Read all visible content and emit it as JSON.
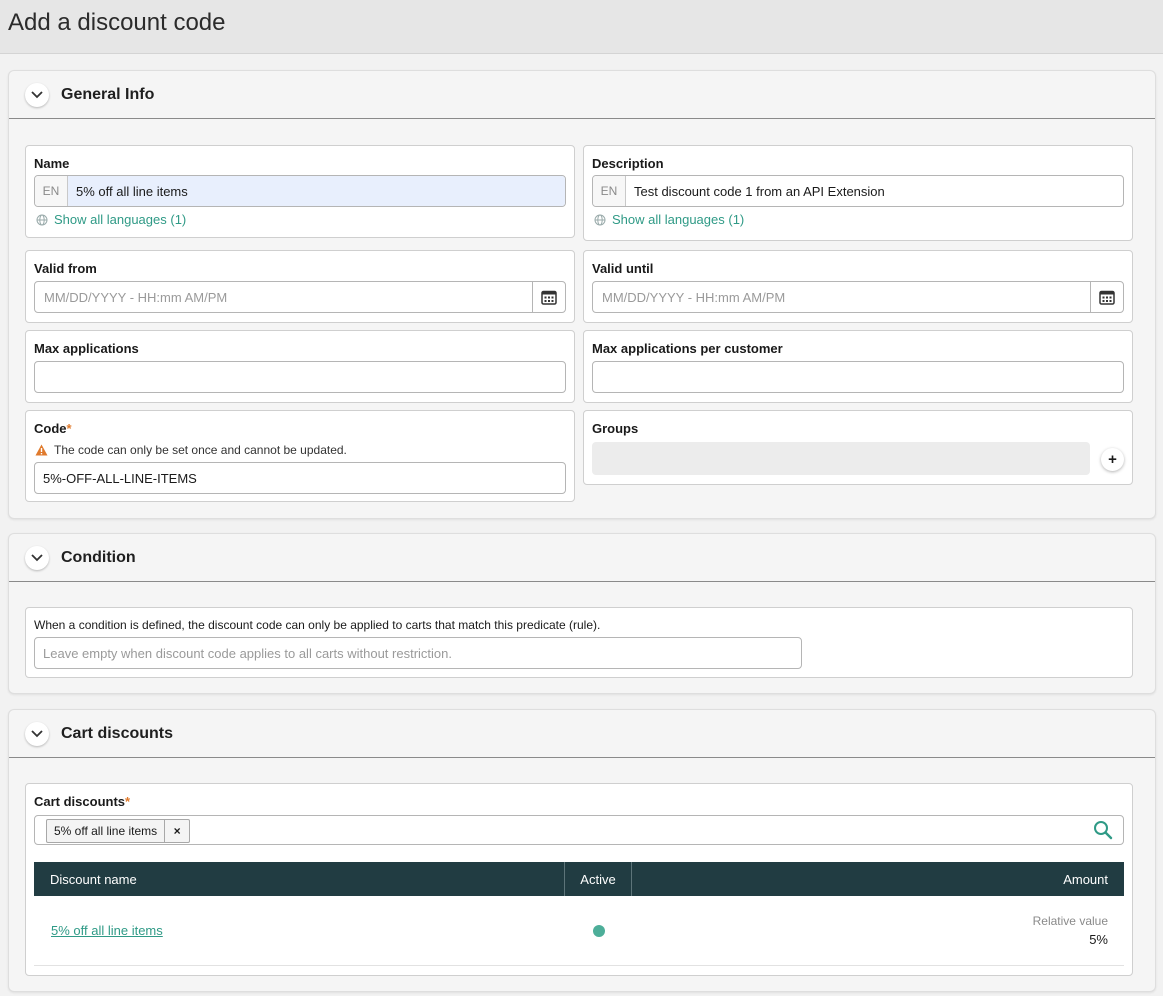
{
  "page": {
    "title": "Add a discount code"
  },
  "general_info": {
    "title": "General Info",
    "name": {
      "label": "Name",
      "lang": "EN",
      "value": "5% off all line items",
      "show_languages": "Show all languages (1)"
    },
    "description": {
      "label": "Description",
      "lang": "EN",
      "value": "Test discount code 1 from an API Extension",
      "show_languages": "Show all languages (1)"
    },
    "valid_from": {
      "label": "Valid from",
      "placeholder": "MM/DD/YYYY - HH:mm AM/PM"
    },
    "valid_until": {
      "label": "Valid until",
      "placeholder": "MM/DD/YYYY - HH:mm AM/PM"
    },
    "max_applications": {
      "label": "Max applications",
      "value": ""
    },
    "max_applications_per_customer": {
      "label": "Max applications per customer",
      "value": ""
    },
    "code": {
      "label": "Code",
      "required_mark": "*",
      "warning": "The code can only be set once and cannot be updated.",
      "value": "5%-OFF-ALL-LINE-ITEMS"
    },
    "groups": {
      "label": "Groups",
      "add": "+"
    }
  },
  "condition": {
    "title": "Condition",
    "description": "When a condition is defined, the discount code can only be applied to carts that match this predicate (rule).",
    "placeholder": "Leave empty when discount code applies to all carts without restriction."
  },
  "cart_discounts": {
    "title": "Cart discounts",
    "field_label": "Cart discounts",
    "required_mark": "*",
    "selected_chip": "5% off all line items",
    "chip_remove": "×",
    "columns": {
      "name": "Discount name",
      "active": "Active",
      "amount": "Amount"
    },
    "rows": [
      {
        "name": "5% off all line items",
        "active": true,
        "amount_type": "Relative value",
        "amount_value": "5%"
      }
    ]
  },
  "colors": {
    "accent": "#2f9a86",
    "grid_header": "#213c42",
    "required": "#e07a2c",
    "active_dot": "#4dae99"
  }
}
